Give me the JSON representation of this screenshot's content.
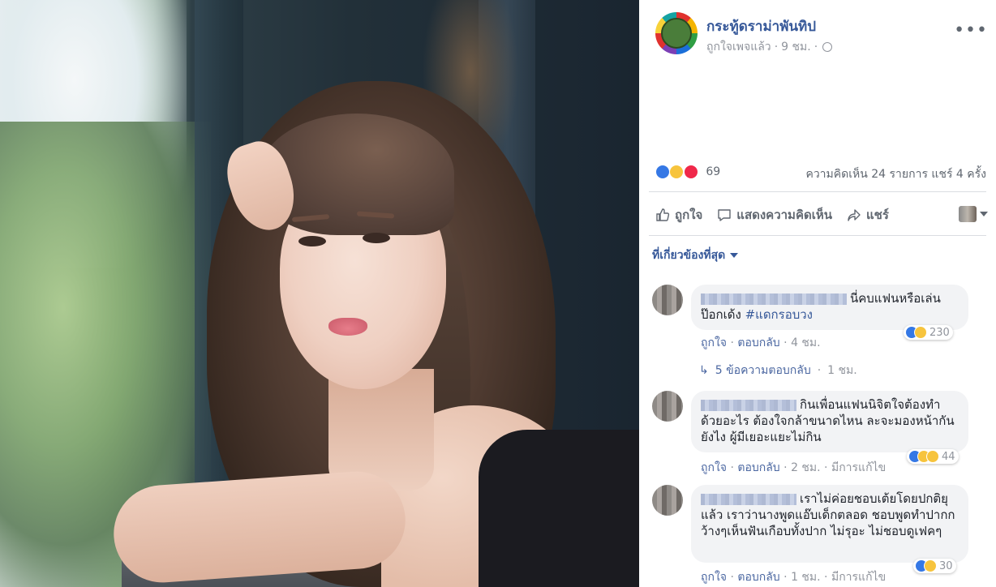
{
  "post": {
    "page_name": "กระทู้ดราม่าพันทิป",
    "meta_followed": "ถูกใจเพจแล้ว",
    "meta_time": "9 ชม.",
    "meta_dot": "·",
    "reaction_count": "69",
    "comment_share_counts": "ความคิดเห็น 24 รายการ  แชร์ 4 ครั้ง",
    "actions": {
      "like": "ถูกใจ",
      "comment": "แสดงความคิดเห็น",
      "share": "แชร์"
    },
    "sort_label": "ที่เกี่ยวข้องที่สุด"
  },
  "comments": [
    {
      "text": "นี่คบแฟนหรือเล่นป๊อกเด้ง ",
      "hashtag": "#แดกรอบวง",
      "reaction_count": "230",
      "like": "ถูกใจ",
      "reply": "ตอบกลับ",
      "time": "4 ชม.",
      "replies_label": "5 ข้อความตอบกลับ",
      "replies_time": "1 ชม."
    },
    {
      "text": "กินเพื่อนแฟนนิจิตใจต้องทำด้วยอะไร ต้องใจกล้าขนาดไหน ละจะมองหน้ากันยังไง ผู้มีเยอะแยะไม่กิน",
      "reaction_count": "44",
      "like": "ถูกใจ",
      "reply": "ตอบกลับ",
      "time": "2 ชม.",
      "edited": "มีการแก้ไข"
    },
    {
      "text": "เราไม่ค่อยชอบเต้ยโดยปกติยุแล้ว เราว่านางพูดแอ๊บเด็กตลอด ชอบพูดทำปากกว้างๆเห็นฟันเกือบทั้งปาก ไม่รุอะ ไม่ชอบดูเฟคๆ",
      "reaction_count": "30",
      "like": "ถูกใจ",
      "reply": "ตอบกลับ",
      "time": "1 ชม.",
      "edited": "มีการแก้ไข"
    }
  ],
  "colors": {
    "link": "#365899",
    "meta": "#90949c",
    "bubble": "#f2f3f5",
    "like_blue": "#3578e5",
    "love_red": "#f0284a",
    "haha_yellow": "#f7c43d"
  },
  "icons": [
    "globe-icon",
    "more-icon",
    "like-icon",
    "comment-icon",
    "share-icon",
    "caret-down-icon",
    "reply-arrow-icon"
  ]
}
